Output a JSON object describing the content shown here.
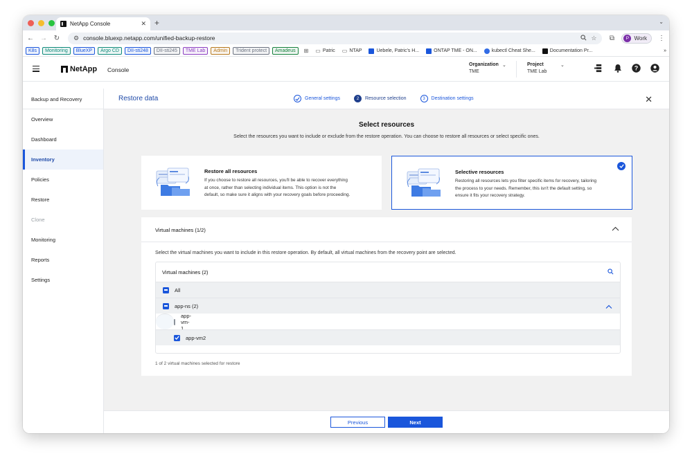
{
  "browser": {
    "tab_title": "NetApp Console",
    "url": "console.bluexp.netapp.com/unified-backup-restore",
    "profile_label": "Work",
    "profile_initial": "P",
    "bookmark_chips": [
      {
        "label": "K8s",
        "color": "#1a56db"
      },
      {
        "label": "Monitoring",
        "color": "#0e8a7a"
      },
      {
        "label": "BlueXP",
        "color": "#1a56db"
      },
      {
        "label": "Argo CD",
        "color": "#0e8a7a"
      },
      {
        "label": "DII-sti248",
        "color": "#1a56db"
      },
      {
        "label": "DII-sti245",
        "color": "#6b7280"
      },
      {
        "label": "TME Lab",
        "color": "#8b3fc1"
      },
      {
        "label": "Admin",
        "color": "#b7791f"
      },
      {
        "label": "Trident protect",
        "color": "#6b7280"
      },
      {
        "label": "Amadeus",
        "color": "#15803d"
      }
    ],
    "bookmark_links": [
      {
        "label": "Patric",
        "icon": "folder-icon"
      },
      {
        "label": "NTAP",
        "icon": "folder-icon"
      },
      {
        "label": "Uebele, Patric's H...",
        "icon": "jira-icon"
      },
      {
        "label": "ONTAP TME - ON...",
        "icon": "jira-icon"
      },
      {
        "label": "kubectl Cheat She...",
        "icon": "k8s-icon"
      },
      {
        "label": "Documentation Pr...",
        "icon": "netapp-icon"
      }
    ],
    "more_label": "»"
  },
  "header": {
    "logo_text": "NetApp",
    "console_label": "Console",
    "organization_title": "Organization",
    "organization_value": "TME",
    "project_title": "Project",
    "project_value": "TME Lab"
  },
  "sidebar": {
    "title": "Backup and Recovery",
    "items": [
      {
        "label": "Overview",
        "state": "normal"
      },
      {
        "label": "Dashboard",
        "state": "normal"
      },
      {
        "label": "Inventory",
        "state": "active"
      },
      {
        "label": "Policies",
        "state": "normal"
      },
      {
        "label": "Restore",
        "state": "normal"
      },
      {
        "label": "Clone",
        "state": "disabled"
      },
      {
        "label": "Monitoring",
        "state": "normal"
      },
      {
        "label": "Reports",
        "state": "normal"
      },
      {
        "label": "Settings",
        "state": "normal"
      }
    ]
  },
  "wizard": {
    "title": "Restore data",
    "steps": [
      {
        "number": "1",
        "label": "General settings",
        "status": "completed"
      },
      {
        "number": "2",
        "label": "Resource selection",
        "status": "current"
      },
      {
        "number": "3",
        "label": "Destination settings",
        "status": "upcoming"
      }
    ]
  },
  "section": {
    "title": "Select resources",
    "subtitle": "Select the resources you want to include or exclude from the restore operation. You can choose to restore all resources or select specific ones."
  },
  "options": [
    {
      "title": "Restore all resources",
      "desc_lines": [
        "If you choose to restore all resources, you'll be able to recover everything",
        "at once, rather than selecting individual items. This option is not the",
        "default, so make sure it aligns with your recovery goals before proceeding."
      ],
      "selected": false
    },
    {
      "title": "Selective resources",
      "desc_lines": [
        "Restoring all resources lets you filter specific items for recovery, tailoring",
        "the process to your needs. Remember, this isn't the default setting, so",
        "ensure it fits your recovery strategy."
      ],
      "selected": true
    }
  ],
  "vm_panel": {
    "title": "Virtual machines (1/2)",
    "description": "Select the virtual machines you want to include in this restore operation. By default, all virtual machines from the recovery point are selected.",
    "table_title": "Virtual machines (2)",
    "all_label": "All",
    "group_label": "app-ns (2)",
    "vms": [
      {
        "name": "app-vm-1",
        "checked": false
      },
      {
        "name": "app-vm2",
        "checked": true
      }
    ],
    "footer_text": "1 of 2 virtual machines selected for restore"
  },
  "footer": {
    "previous_label": "Previous",
    "next_label": "Next"
  },
  "colors": {
    "accent": "#1a56db",
    "accent_dark": "#1f3f8c",
    "page_bg": "#f1f1f1"
  }
}
